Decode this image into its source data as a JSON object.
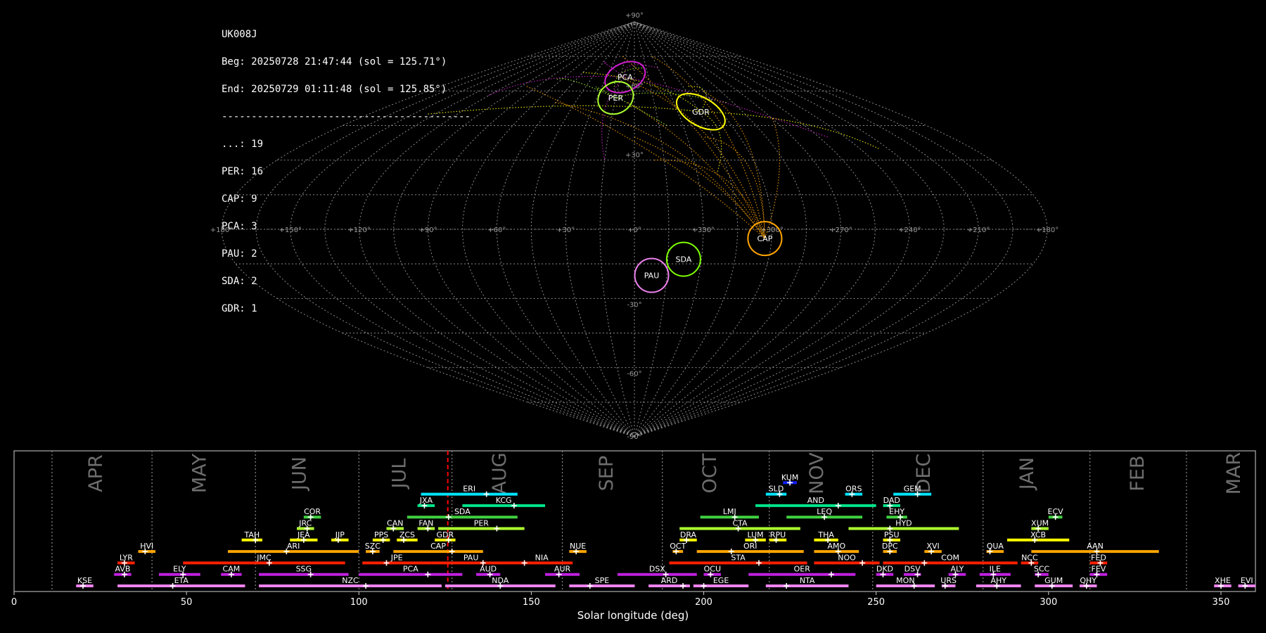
{
  "header": {
    "station": "UK008J",
    "begin": "Beg: 20250728 21:47:44 (sol = 125.71°)",
    "end": "End: 20250729 01:11:48 (sol = 125.85°)",
    "separator": "------------------------------------------",
    "counts": [
      "...: 19",
      "PER: 16",
      "CAP: 9",
      "PCA: 3",
      "PAU: 2",
      "SDA: 2",
      "GDR: 1"
    ]
  },
  "colors": {
    "PER": "#adff2f",
    "CAP": "#ffa500",
    "PCA": "#d020d0",
    "PAU": "#ee82ee",
    "SDA": "#7fff00",
    "GDR": "#ffff00",
    "sporadic": "#ffffff",
    "current_sol": "#ff0000"
  },
  "chart_data": [
    {
      "type": "scatter",
      "projection": "sinusoidal sky map",
      "lon_ticks": [
        "+180°",
        "+150°",
        "+120°",
        "+90°",
        "+60°",
        "+30°",
        "+0°",
        "+330°",
        "+300°",
        "+270°",
        "+240°",
        "+210°",
        "+180°"
      ],
      "lat_ticks": [
        "+90°",
        "+60°",
        "+30°",
        "-30°",
        "-60°",
        "-90°"
      ],
      "radiants": [
        {
          "name": "PCA",
          "lon": 10,
          "lat": 66,
          "color": "#d020d0"
        },
        {
          "name": "PER",
          "lon": 15,
          "lat": 57,
          "color": "#adff2f"
        },
        {
          "name": "GDR",
          "lon": 314,
          "lat": 51,
          "color": "#ffff00"
        },
        {
          "name": "CAP",
          "lon": 303,
          "lat": -4,
          "color": "#ffa500"
        },
        {
          "name": "SDA",
          "lon": 338,
          "lat": -13,
          "color": "#7fff00"
        },
        {
          "name": "PAU",
          "lon": 352,
          "lat": -20,
          "color": "#ee82ee"
        }
      ]
    },
    {
      "type": "bar",
      "xlabel": "Solar longitude (deg)",
      "xlim": [
        0,
        360
      ],
      "xticks": [
        0,
        50,
        100,
        150,
        200,
        250,
        300,
        350
      ],
      "month_bounds": [
        11,
        40,
        70,
        100,
        127,
        159,
        188,
        219,
        249,
        281,
        312,
        340
      ],
      "months": [
        {
          "label": "APR",
          "at": 24
        },
        {
          "label": "MAY",
          "at": 54
        },
        {
          "label": "JUN",
          "at": 83
        },
        {
          "label": "JUL",
          "at": 112
        },
        {
          "label": "AUG",
          "at": 141
        },
        {
          "label": "SEP",
          "at": 172
        },
        {
          "label": "OCT",
          "at": 202
        },
        {
          "label": "NOV",
          "at": 233
        },
        {
          "label": "DEC",
          "at": 264
        },
        {
          "label": "JAN",
          "at": 294
        },
        {
          "label": "FEB",
          "at": 326
        },
        {
          "label": "MAR",
          "at": 354
        }
      ],
      "current_sol": 125.78,
      "showers": [
        {
          "code": "KUM",
          "start": 223,
          "end": 227,
          "peak": 225,
          "row": 10,
          "color": "#1020ff"
        },
        {
          "code": "ERI",
          "start": 118,
          "end": 146,
          "peak": 137,
          "row": 9,
          "color": "#00e5ff"
        },
        {
          "code": "SLD",
          "start": 218,
          "end": 224,
          "peak": 222,
          "row": 9,
          "color": "#00e5ff"
        },
        {
          "code": "ORS",
          "start": 241,
          "end": 246,
          "peak": 243,
          "row": 9,
          "color": "#00e5ff"
        },
        {
          "code": "GEM",
          "start": 255,
          "end": 266,
          "peak": 262,
          "row": 9,
          "color": "#00e5ff"
        },
        {
          "code": "JXA",
          "start": 117,
          "end": 122,
          "peak": 119,
          "row": 8,
          "color": "#00e58a"
        },
        {
          "code": "KCG",
          "start": 130,
          "end": 154,
          "peak": 145,
          "row": 8,
          "color": "#00e58a"
        },
        {
          "code": "AND",
          "start": 215,
          "end": 250,
          "peak": 239,
          "row": 8,
          "color": "#00e58a"
        },
        {
          "code": "DAD",
          "start": 252,
          "end": 257,
          "peak": 254,
          "row": 8,
          "color": "#00e58a"
        },
        {
          "code": "COR",
          "start": 84,
          "end": 89,
          "peak": 86,
          "row": 7,
          "color": "#40d040"
        },
        {
          "code": "SDA",
          "start": 114,
          "end": 146,
          "peak": 126,
          "row": 7,
          "color": "#40d040"
        },
        {
          "code": "LMI",
          "start": 199,
          "end": 216,
          "peak": 209,
          "row": 7,
          "color": "#40d040"
        },
        {
          "code": "LEQ",
          "start": 224,
          "end": 246,
          "peak": 235,
          "row": 7,
          "color": "#40d040"
        },
        {
          "code": "EHY",
          "start": 253,
          "end": 259,
          "peak": 257,
          "row": 7,
          "color": "#40d040"
        },
        {
          "code": "ECV",
          "start": 300,
          "end": 304,
          "peak": 302,
          "row": 7,
          "color": "#40d040"
        },
        {
          "code": "JRC",
          "start": 82,
          "end": 87,
          "peak": 85,
          "row": 6,
          "color": "#adff2f"
        },
        {
          "code": "CAN",
          "start": 108,
          "end": 113,
          "peak": 110,
          "row": 6,
          "color": "#adff2f"
        },
        {
          "code": "FAN",
          "start": 117,
          "end": 122,
          "peak": 120,
          "row": 6,
          "color": "#adff2f"
        },
        {
          "code": "PER",
          "start": 123,
          "end": 148,
          "peak": 140,
          "row": 6,
          "color": "#adff2f"
        },
        {
          "code": "CTA",
          "start": 193,
          "end": 228,
          "peak": 210,
          "row": 6,
          "color": "#adff2f"
        },
        {
          "code": "HYD",
          "start": 242,
          "end": 274,
          "peak": 254,
          "row": 6,
          "color": "#adff2f"
        },
        {
          "code": "XUM",
          "start": 295,
          "end": 300,
          "peak": 297,
          "row": 6,
          "color": "#adff2f"
        },
        {
          "code": "TAH",
          "start": 66,
          "end": 72,
          "peak": 70,
          "row": 5,
          "color": "#ffff00"
        },
        {
          "code": "JEA",
          "start": 80,
          "end": 88,
          "peak": 84,
          "row": 5,
          "color": "#ffff00"
        },
        {
          "code": "JIP",
          "start": 92,
          "end": 97,
          "peak": 94,
          "row": 5,
          "color": "#ffff00"
        },
        {
          "code": "PPS",
          "start": 104,
          "end": 109,
          "peak": 107,
          "row": 5,
          "color": "#ffff00"
        },
        {
          "code": "ZCS",
          "start": 111,
          "end": 117,
          "peak": 113,
          "row": 5,
          "color": "#ffff00"
        },
        {
          "code": "GDR",
          "start": 122,
          "end": 128,
          "peak": 126,
          "row": 5,
          "color": "#ffff00"
        },
        {
          "code": "DRA",
          "start": 193,
          "end": 198,
          "peak": 195,
          "row": 5,
          "color": "#ffff00"
        },
        {
          "code": "LUM",
          "start": 212,
          "end": 218,
          "peak": 215,
          "row": 5,
          "color": "#ffff00"
        },
        {
          "code": "RPU",
          "start": 219,
          "end": 224,
          "peak": 221,
          "row": 5,
          "color": "#ffff00"
        },
        {
          "code": "THA",
          "start": 232,
          "end": 239,
          "peak": 236,
          "row": 5,
          "color": "#ffff00"
        },
        {
          "code": "PSU",
          "start": 252,
          "end": 257,
          "peak": 254,
          "row": 5,
          "color": "#ffff00"
        },
        {
          "code": "XCB",
          "start": 288,
          "end": 306,
          "peak": 296,
          "row": 5,
          "color": "#ffff00"
        },
        {
          "code": "HVI",
          "start": 36,
          "end": 41,
          "peak": 38,
          "row": 4,
          "color": "#ffa500"
        },
        {
          "code": "ARI",
          "start": 62,
          "end": 100,
          "peak": 79,
          "row": 4,
          "color": "#ffa500"
        },
        {
          "code": "SZC",
          "start": 102,
          "end": 106,
          "peak": 104,
          "row": 4,
          "color": "#ffa500"
        },
        {
          "code": "CAP",
          "start": 110,
          "end": 136,
          "peak": 127,
          "row": 4,
          "color": "#ffa500"
        },
        {
          "code": "NUE",
          "start": 161,
          "end": 166,
          "peak": 163,
          "row": 4,
          "color": "#ffa500"
        },
        {
          "code": "OCT",
          "start": 191,
          "end": 194,
          "peak": 192,
          "row": 4,
          "color": "#ffa500"
        },
        {
          "code": "ORI",
          "start": 198,
          "end": 229,
          "peak": 208,
          "row": 4,
          "color": "#ffa500"
        },
        {
          "code": "AMO",
          "start": 232,
          "end": 245,
          "peak": 239,
          "row": 4,
          "color": "#ffa500"
        },
        {
          "code": "DPC",
          "start": 252,
          "end": 256,
          "peak": 254,
          "row": 4,
          "color": "#ffa500"
        },
        {
          "code": "XVI",
          "start": 264,
          "end": 269,
          "peak": 266,
          "row": 4,
          "color": "#ffa500"
        },
        {
          "code": "QUA",
          "start": 282,
          "end": 287,
          "peak": 283,
          "row": 4,
          "color": "#ffa500"
        },
        {
          "code": "AAN",
          "start": 295,
          "end": 332,
          "peak": 314,
          "row": 4,
          "color": "#ffa500"
        },
        {
          "code": "LYR",
          "start": 30,
          "end": 35,
          "peak": 32,
          "row": 3,
          "color": "#ff2000"
        },
        {
          "code": "JMC",
          "start": 49,
          "end": 96,
          "peak": 74,
          "row": 3,
          "color": "#ff2000"
        },
        {
          "code": "JPE",
          "start": 101,
          "end": 121,
          "peak": 108,
          "row": 3,
          "color": "#ff2000"
        },
        {
          "code": "PAU",
          "start": 121,
          "end": 144,
          "peak": 136,
          "row": 3,
          "color": "#ff2000"
        },
        {
          "code": "NIA",
          "start": 144,
          "end": 162,
          "peak": 148,
          "row": 3,
          "color": "#ff2000"
        },
        {
          "code": "STA",
          "start": 190,
          "end": 230,
          "peak": 216,
          "row": 3,
          "color": "#ff2000"
        },
        {
          "code": "NOO",
          "start": 232,
          "end": 251,
          "peak": 246,
          "row": 3,
          "color": "#ff2000"
        },
        {
          "code": "COM",
          "start": 252,
          "end": 291,
          "peak": 264,
          "row": 3,
          "color": "#ff2000"
        },
        {
          "code": "NCC",
          "start": 292,
          "end": 297,
          "peak": 295,
          "row": 3,
          "color": "#ff2000"
        },
        {
          "code": "FED",
          "start": 312,
          "end": 317,
          "peak": 315,
          "row": 3,
          "color": "#ff2000"
        },
        {
          "code": "AVB",
          "start": 29,
          "end": 34,
          "peak": 32,
          "row": 2,
          "color": "#c020e0"
        },
        {
          "code": "ELY",
          "start": 42,
          "end": 54,
          "peak": 49,
          "row": 2,
          "color": "#c020e0"
        },
        {
          "code": "CAM",
          "start": 60,
          "end": 66,
          "peak": 63,
          "row": 2,
          "color": "#c020e0"
        },
        {
          "code": "SSG",
          "start": 71,
          "end": 97,
          "peak": 86,
          "row": 2,
          "color": "#c020e0"
        },
        {
          "code": "PCA",
          "start": 100,
          "end": 130,
          "peak": 120,
          "row": 2,
          "color": "#c020e0"
        },
        {
          "code": "AUD",
          "start": 134,
          "end": 141,
          "peak": 138,
          "row": 2,
          "color": "#c020e0"
        },
        {
          "code": "AUR",
          "start": 154,
          "end": 164,
          "peak": 158,
          "row": 2,
          "color": "#c020e0"
        },
        {
          "code": "DSX",
          "start": 175,
          "end": 198,
          "peak": 189,
          "row": 2,
          "color": "#c020e0"
        },
        {
          "code": "OCU",
          "start": 200,
          "end": 205,
          "peak": 202,
          "row": 2,
          "color": "#c020e0"
        },
        {
          "code": "OER",
          "start": 213,
          "end": 244,
          "peak": 237,
          "row": 2,
          "color": "#c020e0"
        },
        {
          "code": "DKD",
          "start": 250,
          "end": 255,
          "peak": 252,
          "row": 2,
          "color": "#c020e0"
        },
        {
          "code": "DSV",
          "start": 258,
          "end": 263,
          "peak": 262,
          "row": 2,
          "color": "#c020e0"
        },
        {
          "code": "ALY",
          "start": 271,
          "end": 276,
          "peak": 273,
          "row": 2,
          "color": "#c020e0"
        },
        {
          "code": "ILE",
          "start": 280,
          "end": 289,
          "peak": 284,
          "row": 2,
          "color": "#c020e0"
        },
        {
          "code": "SCC",
          "start": 296,
          "end": 300,
          "peak": 297,
          "row": 2,
          "color": "#c020e0"
        },
        {
          "code": "FEV",
          "start": 312,
          "end": 317,
          "peak": 314,
          "row": 2,
          "color": "#c020e0"
        },
        {
          "code": "KSE",
          "start": 18,
          "end": 23,
          "peak": 20,
          "row": 1,
          "color": "#ee82ee"
        },
        {
          "code": "ETA",
          "start": 30,
          "end": 67,
          "peak": 46,
          "row": 1,
          "color": "#ee82ee"
        },
        {
          "code": "NZC",
          "start": 71,
          "end": 124,
          "peak": 102,
          "row": 1,
          "color": "#ee82ee"
        },
        {
          "code": "NDA",
          "start": 125,
          "end": 157,
          "peak": 141,
          "row": 1,
          "color": "#ee82ee"
        },
        {
          "code": "SPE",
          "start": 161,
          "end": 180,
          "peak": 167,
          "row": 1,
          "color": "#ee82ee"
        },
        {
          "code": "ARD",
          "start": 184,
          "end": 196,
          "peak": 194,
          "row": 1,
          "color": "#ee82ee"
        },
        {
          "code": "EGE",
          "start": 197,
          "end": 213,
          "peak": 200,
          "row": 1,
          "color": "#ee82ee"
        },
        {
          "code": "NTA",
          "start": 218,
          "end": 242,
          "peak": 224,
          "row": 1,
          "color": "#ee82ee"
        },
        {
          "code": "MON",
          "start": 250,
          "end": 267,
          "peak": 261,
          "row": 1,
          "color": "#ee82ee"
        },
        {
          "code": "URS",
          "start": 269,
          "end": 273,
          "peak": 270,
          "row": 1,
          "color": "#ee82ee"
        },
        {
          "code": "AHY",
          "start": 279,
          "end": 292,
          "peak": 285,
          "row": 1,
          "color": "#ee82ee"
        },
        {
          "code": "GUM",
          "start": 296,
          "end": 307,
          "peak": 301,
          "row": 1,
          "color": "#ee82ee"
        },
        {
          "code": "QHY",
          "start": 309,
          "end": 314,
          "peak": 311,
          "row": 1,
          "color": "#ee82ee"
        },
        {
          "code": "XHE",
          "start": 348,
          "end": 353,
          "peak": 350,
          "row": 1,
          "color": "#ee82ee"
        },
        {
          "code": "EVI",
          "start": 355,
          "end": 360,
          "peak": 357,
          "row": 1,
          "color": "#ee82ee"
        }
      ]
    }
  ]
}
